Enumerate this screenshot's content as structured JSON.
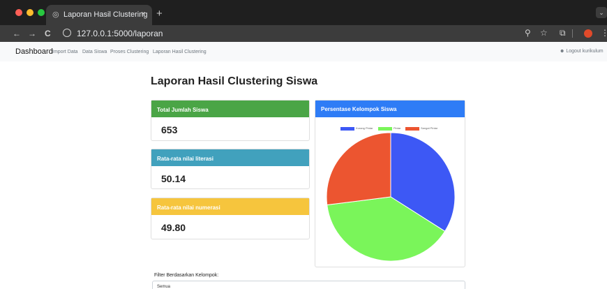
{
  "browser": {
    "tab_title": "Laporan Hasil Clustering",
    "tab_close": "×",
    "new_tab": "+",
    "url": "127.0.0.1:5000/laporan",
    "back": "←",
    "forward": "→",
    "reload": "C",
    "zoom_icon": "⚲",
    "star_icon": "☆",
    "extensions_icon": "⧉",
    "menu_icon": "⋮",
    "tab_list_icon": "⌄"
  },
  "nav": {
    "brand": "Dashboard",
    "links": [
      "Import Data",
      "Data Siswa",
      "Proses Clustering",
      "Laporan Hasil Clustering"
    ],
    "logout": "Logout kurikulum"
  },
  "page": {
    "title": "Laporan Hasil Clustering Siswa"
  },
  "stats": [
    {
      "label": "Total Jumlah Siswa",
      "value": "653",
      "color": "#4aa546"
    },
    {
      "label": "Rata-rata nilai literasi",
      "value": "50.14",
      "color": "#41a1bd"
    },
    {
      "label": "Rata-rata nilai numerasi",
      "value": "49.80",
      "color": "#f6c53d"
    }
  ],
  "chart_card": {
    "title": "Persentase Kelompok Siswa",
    "header_color": "#2e7cf6"
  },
  "chart_data": {
    "type": "pie",
    "title": "",
    "categories": [
      "Kurang Pintar",
      "Pintar",
      "Sangat Pintar"
    ],
    "values": [
      34,
      39,
      27
    ],
    "colors": [
      "#3d58f5",
      "#7af55a",
      "#ec5530"
    ]
  },
  "filter": {
    "label": "Filter Berdasarkan Kelompok:",
    "selected": "Semua"
  }
}
